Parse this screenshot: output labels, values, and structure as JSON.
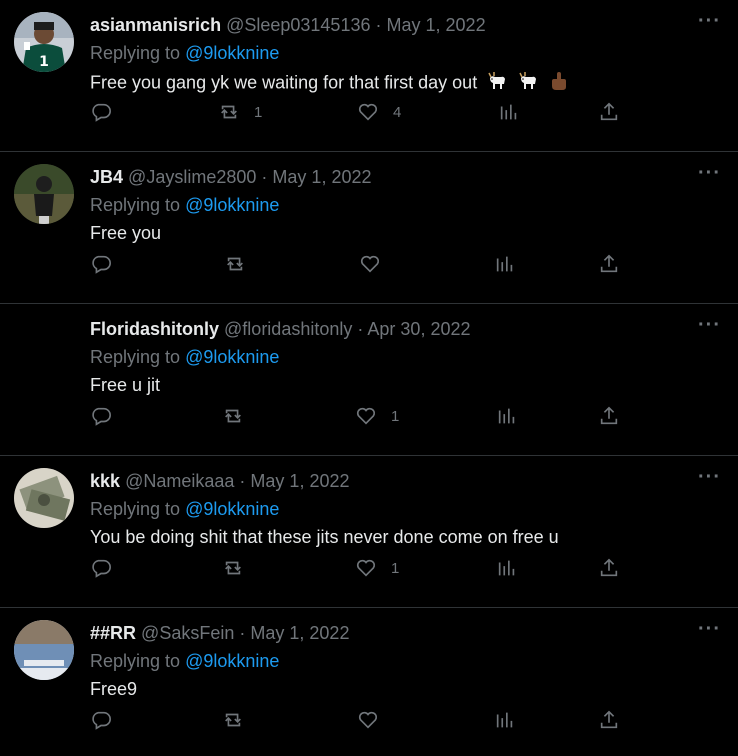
{
  "tweets": [
    {
      "name": "asianmanisrich",
      "handle": "@Sleep03145136",
      "date": "May 1, 2022",
      "replying_prefix": "Replying to",
      "replying_handle": "@9lokknine",
      "text": "Free you gang yk we waiting for that first day out",
      "emojis": [
        "goat-emoji",
        "goat-emoji",
        "middle-finger-emoji"
      ],
      "retweets": "1",
      "likes": "4",
      "avatar": "avatar-jersey"
    },
    {
      "name": "JB4",
      "handle": "@Jayslime2800",
      "date": "May 1, 2022",
      "replying_prefix": "Replying to",
      "replying_handle": "@9lokknine",
      "text": "Free you",
      "retweets": "",
      "likes": "",
      "avatar": "avatar-person-green"
    },
    {
      "name": "Floridashitonly",
      "handle": "@floridashitonly",
      "date": "Apr 30, 2022",
      "replying_prefix": "Replying to",
      "replying_handle": "@9lokknine",
      "text": "Free u jit",
      "retweets": "",
      "likes": "1",
      "avatar": "none"
    },
    {
      "name": "kkk",
      "handle": "@Nameikaaa",
      "date": "May 1, 2022",
      "replying_prefix": "Replying to",
      "replying_handle": "@9lokknine",
      "text": "You be doing shit that these jits never done come on free u",
      "retweets": "",
      "likes": "1",
      "avatar": "avatar-cash"
    },
    {
      "name": "##RR",
      "handle": "@SaksFein",
      "date": "May 1, 2022",
      "replying_prefix": "Replying to",
      "replying_handle": "@9lokknine",
      "text": "Free9",
      "retweets": "",
      "likes": "",
      "avatar": "avatar-photo-blue"
    }
  ],
  "colors": {
    "background": "#000000",
    "text": "#e7e9ea",
    "muted": "#71767b",
    "link": "#1d9bf0",
    "divider": "#2f3336"
  }
}
